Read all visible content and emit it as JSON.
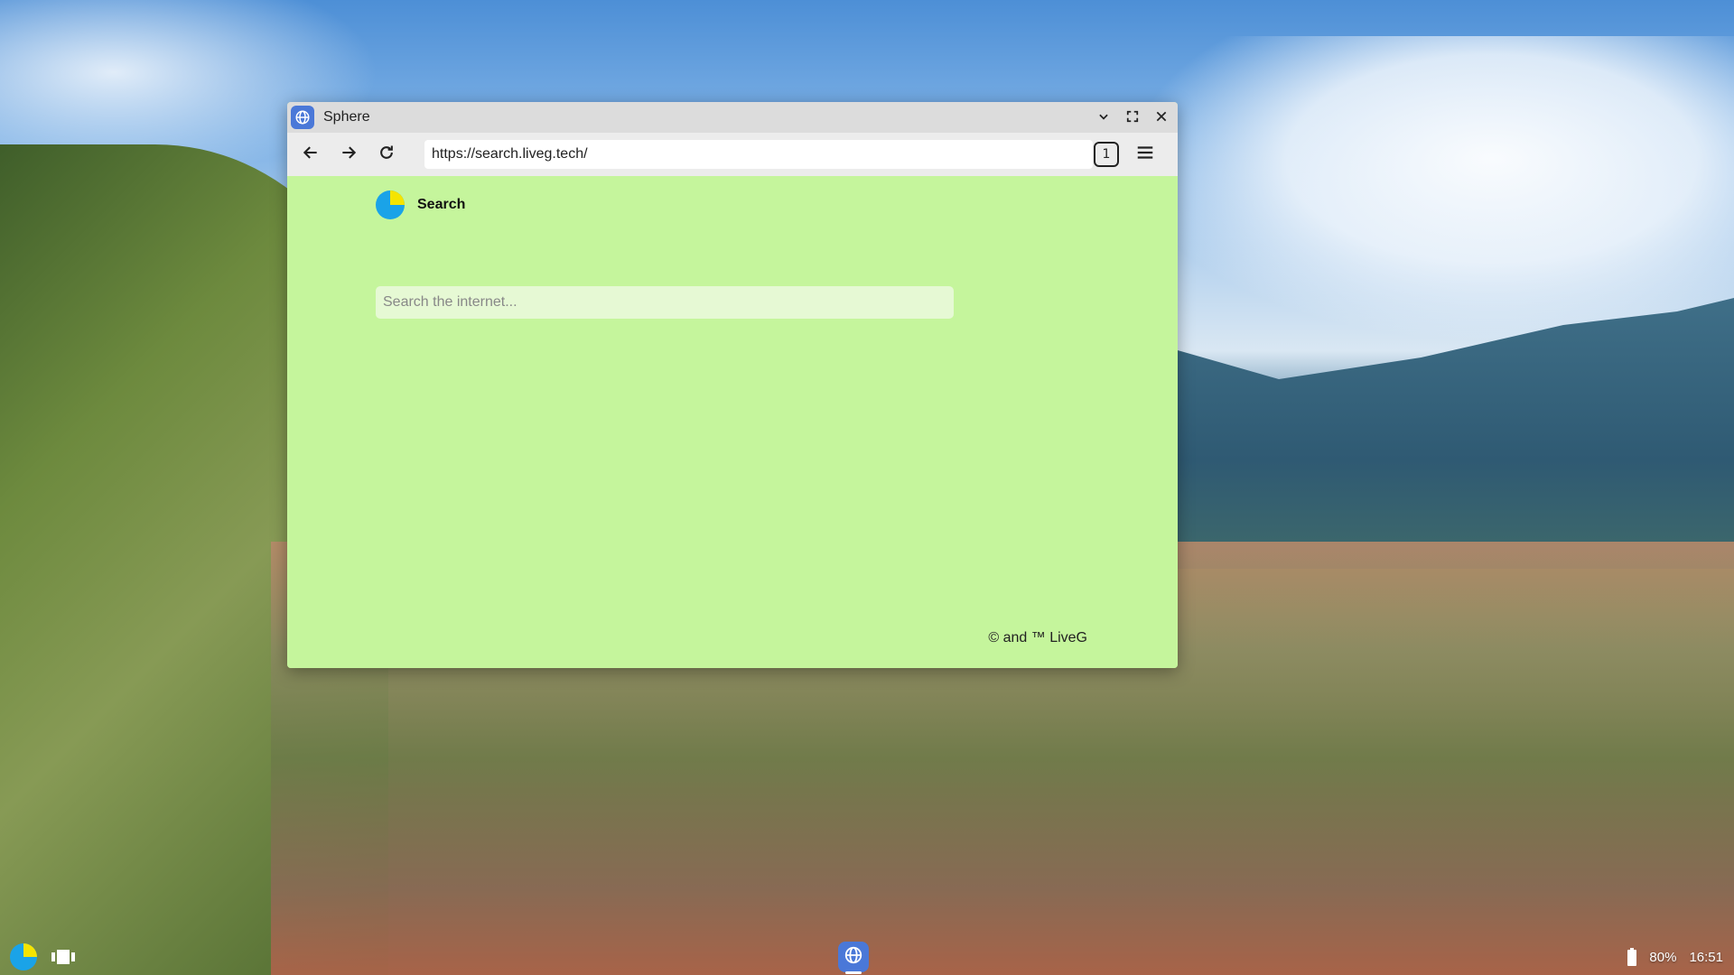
{
  "window": {
    "title": "Sphere",
    "app_icon": "globe-icon"
  },
  "toolbar": {
    "url": "https://search.liveg.tech/",
    "tab_count": "1"
  },
  "page": {
    "brand_name": "Search",
    "search_placeholder": "Search the internet...",
    "footer": "© and ™ LiveG"
  },
  "tray": {
    "battery": "80%",
    "time": "16:51"
  },
  "colors": {
    "page_background": "#c5f59c",
    "accent_blue": "#4a78d8",
    "logo_cyan": "#1aa3e8",
    "logo_yellow": "#f5e400"
  }
}
